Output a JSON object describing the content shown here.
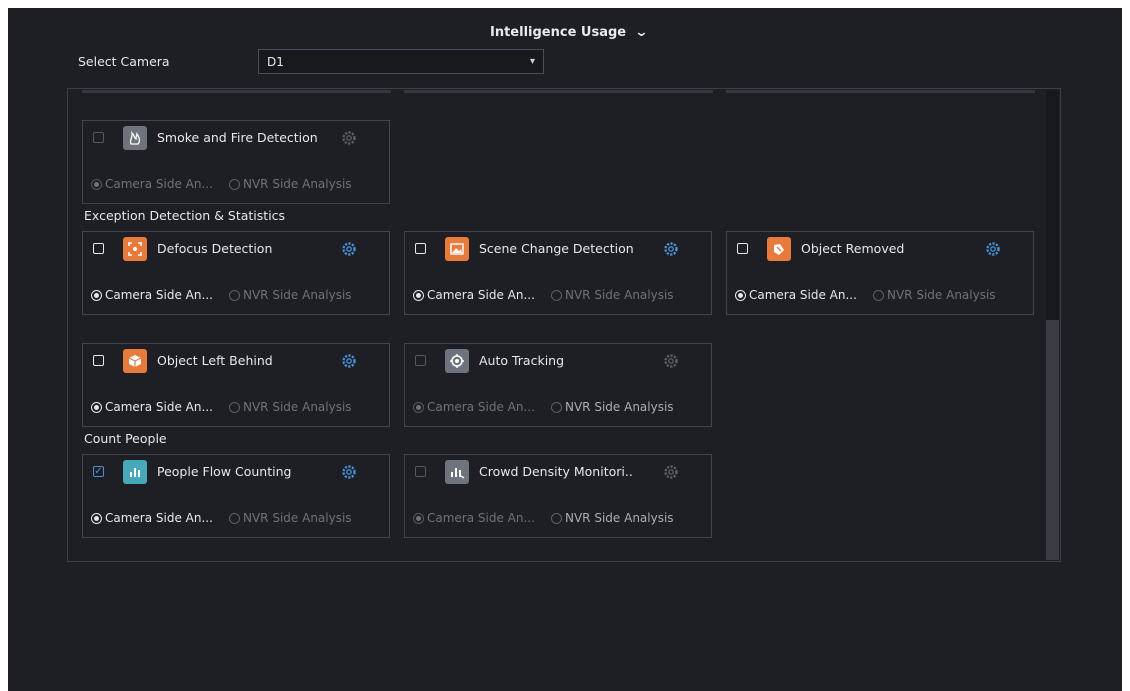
{
  "header": {
    "title": "Intelligence Usage",
    "collapse_icon": "chevron-down-icon"
  },
  "camera": {
    "label": "Select Camera",
    "value": "D1"
  },
  "options": {
    "camera_side": "Camera Side An...",
    "nvr_side": "NVR Side Analysis"
  },
  "sections": {
    "exception": "Exception Detection & Statistics",
    "count": "Count People"
  },
  "features": {
    "smoke_fire": {
      "name": "Smoke and Fire Detection",
      "icon": "smoke-fire-icon",
      "checked": false
    },
    "defocus": {
      "name": "Defocus Detection",
      "icon": "defocus-icon",
      "checked": false
    },
    "scene_change": {
      "name": "Scene Change Detection",
      "icon": "scene-change-icon",
      "checked": false
    },
    "object_removed": {
      "name": "Object Removed",
      "icon": "object-removed-icon",
      "checked": false
    },
    "object_left": {
      "name": "Object Left Behind",
      "icon": "object-left-icon",
      "checked": false
    },
    "auto_tracking": {
      "name": "Auto Tracking",
      "icon": "auto-tracking-icon",
      "checked": false
    },
    "people_flow": {
      "name": "People Flow Counting",
      "icon": "people-flow-icon",
      "checked": true
    },
    "crowd_density": {
      "name": "Crowd Density Monitori..",
      "icon": "crowd-density-icon",
      "checked": false
    }
  },
  "colors": {
    "background": "#1d1f24",
    "accent_blue": "#4a90d9",
    "icon_orange": "#e87a3c",
    "icon_teal": "#48a9b8",
    "disabled_text": "#6e7279"
  }
}
